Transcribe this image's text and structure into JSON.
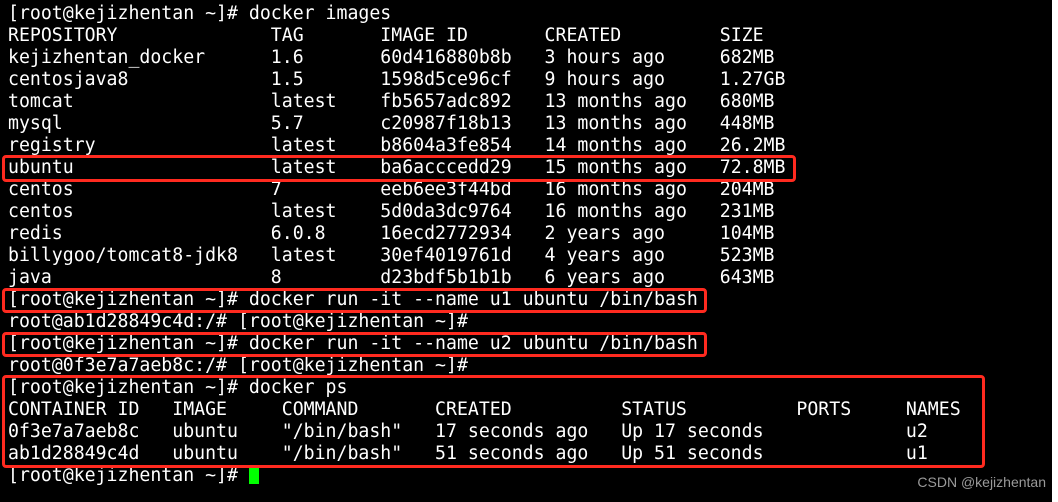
{
  "terminal": {
    "prompt": "[root@kejizhentan ~]# ",
    "cmd_images": "docker images",
    "images_headers": [
      "REPOSITORY",
      "TAG",
      "IMAGE ID",
      "CREATED",
      "SIZE"
    ],
    "images_rows": [
      [
        "kejizhentan_docker",
        "1.6",
        "60d416880b8b",
        "3 hours ago",
        "682MB"
      ],
      [
        "centosjava8",
        "1.5",
        "1598d5ce96cf",
        "9 hours ago",
        "1.27GB"
      ],
      [
        "tomcat",
        "latest",
        "fb5657adc892",
        "13 months ago",
        "680MB"
      ],
      [
        "mysql",
        "5.7",
        "c20987f18b13",
        "13 months ago",
        "448MB"
      ],
      [
        "registry",
        "latest",
        "b8604a3fe854",
        "14 months ago",
        "26.2MB"
      ],
      [
        "ubuntu",
        "latest",
        "ba6acccedd29",
        "15 months ago",
        "72.8MB"
      ],
      [
        "centos",
        "7",
        "eeb6ee3f44bd",
        "16 months ago",
        "204MB"
      ],
      [
        "centos",
        "latest",
        "5d0da3dc9764",
        "16 months ago",
        "231MB"
      ],
      [
        "redis",
        "6.0.8",
        "16ecd2772934",
        "2 years ago",
        "104MB"
      ],
      [
        "billygoo/tomcat8-jdk8",
        "latest",
        "30ef4019761d",
        "4 years ago",
        "523MB"
      ],
      [
        "java",
        "8",
        "d23bdf5b1b1b",
        "6 years ago",
        "643MB"
      ]
    ],
    "cmd_run_u1": "docker run -it --name u1 ubuntu /bin/bash",
    "out_u1": "root@ab1d28849c4d:/# [root@kejizhentan ~]#",
    "cmd_run_u2": "docker run -it --name u2 ubuntu /bin/bash",
    "out_u2": "root@0f3e7a7aeb8c:/# [root@kejizhentan ~]#",
    "cmd_ps": "docker ps",
    "ps_headers": [
      "CONTAINER ID",
      "IMAGE",
      "COMMAND",
      "CREATED",
      "STATUS",
      "PORTS",
      "NAMES"
    ],
    "ps_rows": [
      [
        "0f3e7a7aeb8c",
        "ubuntu",
        "\"/bin/bash\"",
        "17 seconds ago",
        "Up 17 seconds",
        "",
        "u2"
      ],
      [
        "ab1d28849c4d",
        "ubuntu",
        "\"/bin/bash\"",
        "51 seconds ago",
        "Up 51 seconds",
        "",
        "u1"
      ]
    ],
    "final_prompt": "[root@kejizhentan ~]# "
  },
  "watermark": "CSDN @kejizhentan",
  "colors": {
    "background": "#000000",
    "text": "#ffffff",
    "highlight_box": "#ff2a1f",
    "cursor": "#00ff00"
  }
}
